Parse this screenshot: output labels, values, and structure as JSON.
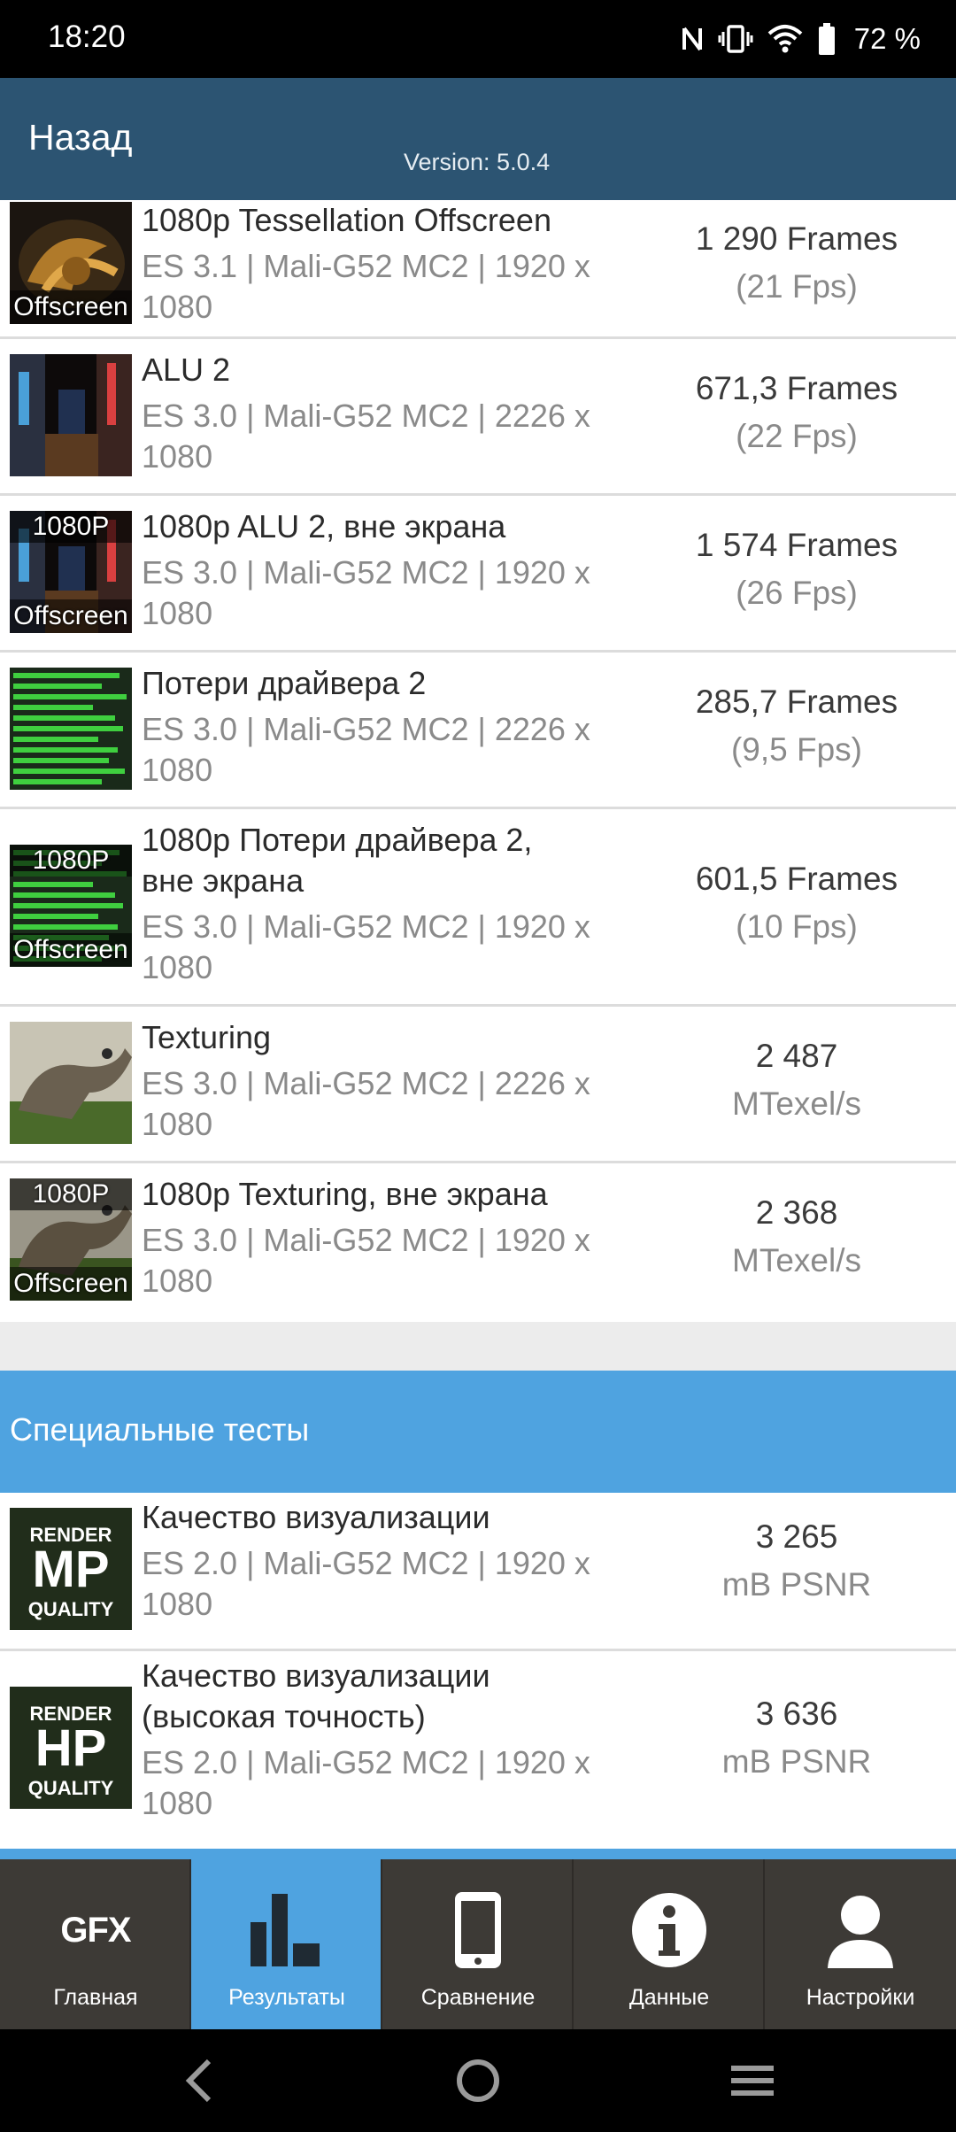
{
  "status_bar": {
    "time": "18:20",
    "battery_percent": "72 %",
    "icons": [
      "nfc-icon",
      "vibrate-icon",
      "wifi-icon",
      "battery-icon"
    ]
  },
  "header": {
    "back_label": "Назад",
    "version": "Version: 5.0.4",
    "color": "#2c5472"
  },
  "tests": [
    {
      "title": "1080p Tessellation Offscreen",
      "sub1": "ES 3.1 | Mali-G52 MC2 | 1920 x",
      "sub2": "1080",
      "value": "1 290 Frames",
      "unit": "(21 Fps)",
      "thumb_top": "",
      "thumb_bottom": "Offscreen",
      "thumb_icon": "tessellation-thumbnail"
    },
    {
      "title": "ALU 2",
      "sub1": "ES 3.0 | Mali-G52 MC2 | 2226 x",
      "sub2": "1080",
      "value": "671,3 Frames",
      "unit": "(22 Fps)",
      "thumb_top": "",
      "thumb_bottom": "",
      "thumb_icon": "alu-thumbnail"
    },
    {
      "title": "1080p ALU 2, вне экрана",
      "sub1": "ES 3.0 | Mali-G52 MC2 | 1920 x",
      "sub2": "1080",
      "value": "1 574 Frames",
      "unit": "(26 Fps)",
      "thumb_top": "1080P",
      "thumb_bottom": "Offscreen",
      "thumb_icon": "alu-thumbnail"
    },
    {
      "title": "Потери драйвера 2",
      "sub1": "ES 3.0 | Mali-G52 MC2 | 2226 x",
      "sub2": "1080",
      "value": "285,7 Frames",
      "unit": "(9,5 Fps)",
      "thumb_top": "",
      "thumb_bottom": "",
      "thumb_icon": "driver-overhead-thumbnail"
    },
    {
      "title": "1080p Потери драйвера 2,",
      "title2": "вне экрана",
      "sub1": "ES 3.0 | Mali-G52 MC2 | 1920 x",
      "sub2": "1080",
      "value": "601,5 Frames",
      "unit": "(10 Fps)",
      "thumb_top": "1080P",
      "thumb_bottom": "Offscreen",
      "thumb_icon": "driver-overhead-thumbnail"
    },
    {
      "title": "Texturing",
      "sub1": "ES 3.0 | Mali-G52 MC2 | 2226 x",
      "sub2": "1080",
      "value": "2 487",
      "unit": "MTexel/s",
      "thumb_top": "",
      "thumb_bottom": "",
      "thumb_icon": "texturing-thumbnail"
    },
    {
      "title": "1080p Texturing, вне экрана",
      "sub1": "ES 3.0 | Mali-G52 MC2 | 1920 x",
      "sub2": "1080",
      "value": "2 368",
      "unit": "MTexel/s",
      "thumb_top": "1080P",
      "thumb_bottom": "Offscreen",
      "thumb_icon": "texturing-thumbnail"
    }
  ],
  "section": {
    "title": "Специальные тесты",
    "color": "#4fa3e0"
  },
  "special_tests": [
    {
      "title": "Качество визуализации",
      "sub1": "ES 2.0 | Mali-G52 MC2 | 1920 x",
      "sub2": "1080",
      "value": "3 265",
      "unit": "mB PSNR",
      "badge_top": "RENDER",
      "badge_main": "MP",
      "badge_bottom": "QUALITY"
    },
    {
      "title": "Качество визуализации",
      "title2": "(высокая точность)",
      "sub1": "ES 2.0 | Mali-G52 MC2 | 1920 x",
      "sub2": "1080",
      "value": "3 636",
      "unit": "mB PSNR",
      "badge_top": "RENDER",
      "badge_main": "HP",
      "badge_bottom": "QUALITY"
    }
  ],
  "bottom_nav": [
    {
      "label": "Главная",
      "icon": "gfx-logo-icon",
      "logo_text": "GFX",
      "active": false
    },
    {
      "label": "Результаты",
      "icon": "bar-chart-icon",
      "active": true
    },
    {
      "label": "Сравнение",
      "icon": "phone-icon",
      "active": false
    },
    {
      "label": "Данные",
      "icon": "info-icon",
      "active": false
    },
    {
      "label": "Настройки",
      "icon": "user-icon",
      "active": false
    }
  ],
  "system_nav": [
    "back-icon",
    "home-icon",
    "menu-icon"
  ]
}
